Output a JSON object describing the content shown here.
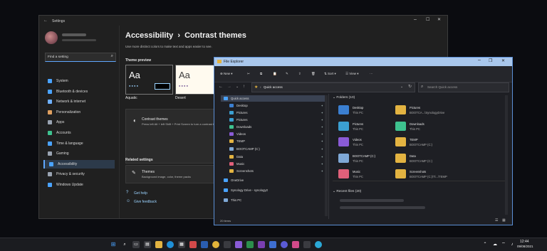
{
  "settings": {
    "window_title": "Settings",
    "search_placeholder": "Find a setting",
    "nav": [
      {
        "label": "System",
        "color": "#4aa3ff"
      },
      {
        "label": "Bluetooth & devices",
        "color": "#4aa3ff"
      },
      {
        "label": "Network & internet",
        "color": "#6fb1ff"
      },
      {
        "label": "Personalization",
        "color": "#e0a060"
      },
      {
        "label": "Apps",
        "color": "#9aa4b2"
      },
      {
        "label": "Accounts",
        "color": "#3ec28f"
      },
      {
        "label": "Time & language",
        "color": "#4aa3ff"
      },
      {
        "label": "Gaming",
        "color": "#9aa4b2"
      },
      {
        "label": "Accessibility",
        "color": "#4aa3ff"
      },
      {
        "label": "Privacy & security",
        "color": "#9aa4b2"
      },
      {
        "label": "Windows Update",
        "color": "#4aa3ff"
      }
    ],
    "breadcrumb_parent": "Accessibility",
    "breadcrumb_sep": "›",
    "breadcrumb_current": "Contrast themes",
    "subtitle": "Use more distinct colors to make text and apps easier to see.",
    "theme_preview_label": "Theme preview",
    "themes": [
      {
        "name": "Aquatic",
        "sample": "Aa"
      },
      {
        "name": "Desert",
        "sample": "Aa"
      }
    ],
    "contrast_card_title": "Contrast themes",
    "contrast_card_desc": "Press left Alt + left Shift + Print Screen to turn a contrast theme on or off",
    "related_label": "Related settings",
    "related_title": "Themes",
    "related_desc": "Background image, color, theme packs",
    "help_link": "Get help",
    "feedback_link": "Give feedback"
  },
  "explorer": {
    "title": "File Explorer",
    "new_label": "New",
    "sort_label": "Sort",
    "view_label": "View",
    "address": "Quick access",
    "search_placeholder": "Search Quick access",
    "nav": [
      {
        "label": "Quick access",
        "color": "#4aa3ff"
      },
      {
        "label": "Desktop",
        "color": "#3b7fd1"
      },
      {
        "label": "Pictures",
        "color": "#3b9fd1"
      },
      {
        "label": "Pictures",
        "color": "#3b9fd1"
      },
      {
        "label": "Downloads",
        "color": "#3ec28f"
      },
      {
        "label": "Videos",
        "color": "#8a5bd6"
      },
      {
        "label": "TEMP",
        "color": "#e3b341"
      },
      {
        "label": "BOOTCAMP (C:)",
        "color": "#7fa8d6"
      },
      {
        "label": "Data",
        "color": "#e3b341"
      },
      {
        "label": "Music",
        "color": "#e0607a"
      },
      {
        "label": "Screenshots",
        "color": "#e3b341"
      },
      {
        "label": "OneDrive",
        "color": "#4aa3ff"
      },
      {
        "label": "Synology Drive - synology2",
        "color": "#4aa3ff"
      },
      {
        "label": "This PC",
        "color": "#7fa8d6"
      }
    ],
    "folders_header": "Folders (10)",
    "folders": [
      {
        "name": "Desktop",
        "loc": "This PC",
        "color": "#3b7fd1"
      },
      {
        "name": "Pictures",
        "loc": "BOOTCA...\\SynologyDrive",
        "color": "#e3b341"
      },
      {
        "name": "Pictures",
        "loc": "This PC",
        "color": "#3b9fd1"
      },
      {
        "name": "Downloads",
        "loc": "This PC",
        "color": "#3ec28f"
      },
      {
        "name": "Videos",
        "loc": "This PC",
        "color": "#8a5bd6"
      },
      {
        "name": "TEMP",
        "loc": "BOOTCAMP (C:)",
        "color": "#e3b341"
      },
      {
        "name": "BOOTCAMP (C:)",
        "loc": "This PC",
        "color": "#7fa8d6"
      },
      {
        "name": "Data",
        "loc": "BOOTCAMP (C:)",
        "color": "#e3b341"
      },
      {
        "name": "Music",
        "loc": "This PC",
        "color": "#e0607a"
      },
      {
        "name": "Screenshots",
        "loc": "BOOTCAMP (C:)\\Ti...\\TEMP",
        "color": "#e3b341"
      }
    ],
    "recent_header": "Recent files (20)",
    "status": "20 items"
  },
  "taskbar": {
    "time": "12:44",
    "date": "09/08/2021"
  }
}
